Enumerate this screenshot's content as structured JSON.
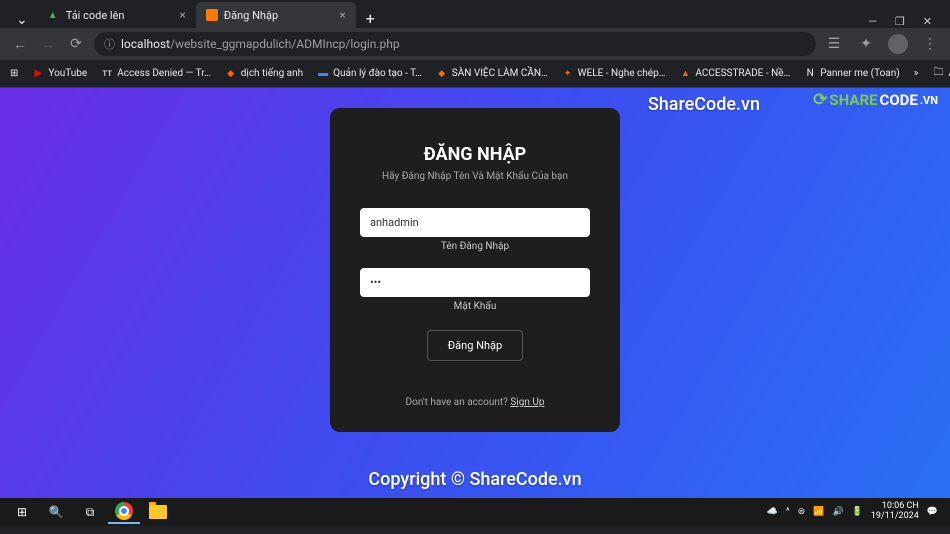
{
  "tabs": [
    {
      "title": "Tải code lên",
      "favicon_color": "#4caf50"
    },
    {
      "title": "Đăng Nhập",
      "favicon_color": "#ff7b00"
    }
  ],
  "url": {
    "host": "localhost",
    "path": "/website_ggmapdulich/ADMIncp/login.php"
  },
  "bookmarks": {
    "youtube": "YouTube",
    "access_denied": "Access Denied — Tr…",
    "dich": "dịch tiếng anh",
    "quanly": "Quản lý đào tạo - T…",
    "sanviec": "SÀN VIỆC LÀM CẦN…",
    "wele": "WELE - Nghe chép…",
    "accesstrade": "ACCESSTRADE - Nề…",
    "panner": "Panner me (Toan)",
    "all": "All Bookmarks"
  },
  "watermarks": {
    "top": "ShareCode.vn",
    "bottom": "Copyright © ShareCode.vn",
    "logo_share": "SHARE",
    "logo_code": "CODE",
    "logo_vn": ".VN"
  },
  "login": {
    "title": "ĐĂNG NHẬP",
    "subtitle": "Hãy Đăng Nhập Tên Và Mật Khẩu Của bạn",
    "username_value": "anhadmin",
    "username_label": "Tên Đăng Nhập",
    "password_value": "•••",
    "password_label": "Mật Khẩu",
    "button": "Đăng Nhập",
    "signup_prompt": "Don't have an account? ",
    "signup_link": "Sign Up"
  },
  "taskbar": {
    "time": "10:06 CH",
    "date": "19/11/2024"
  }
}
